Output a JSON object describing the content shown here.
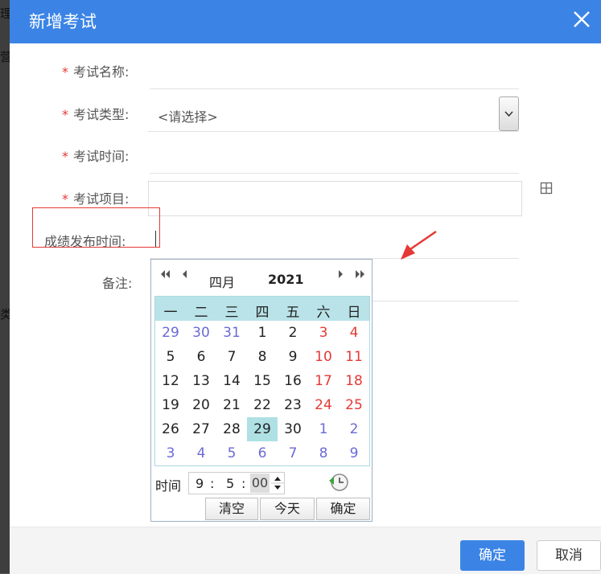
{
  "background": {
    "fragment_1": "理",
    "fragment_2": "营",
    "fragment_3": "类"
  },
  "dialog": {
    "title": "新增考试",
    "close_icon": "close-icon"
  },
  "form": {
    "required_mark": "*",
    "exam_name_label": "考试名称:",
    "exam_type_label": "考试类型:",
    "exam_type_value": "<请选择>",
    "exam_time_label": "考试时间:",
    "exam_item_label": "考试项目:",
    "result_time_label": "成绩发布时间:",
    "remark_label": "备注:"
  },
  "calendar": {
    "month": "四月",
    "year": "2021",
    "weekdays": [
      "一",
      "二",
      "三",
      "四",
      "五",
      "六",
      "日"
    ],
    "weeks": [
      [
        "29",
        "30",
        "31",
        "1",
        "2",
        "3",
        "4"
      ],
      [
        "5",
        "6",
        "7",
        "8",
        "9",
        "10",
        "11"
      ],
      [
        "12",
        "13",
        "14",
        "15",
        "16",
        "17",
        "18"
      ],
      [
        "19",
        "20",
        "21",
        "22",
        "23",
        "24",
        "25"
      ],
      [
        "26",
        "27",
        "28",
        "29",
        "30",
        "1",
        "2"
      ],
      [
        "3",
        "4",
        "5",
        "6",
        "7",
        "8",
        "9"
      ]
    ],
    "selected_day": "29",
    "time_label": "时间",
    "hour": "9",
    "minute": "5",
    "second": "00",
    "clear_label": "清空",
    "today_label": "今天",
    "confirm_label": "确定"
  },
  "footer": {
    "confirm_label": "确定",
    "cancel_label": "取消"
  },
  "colors": {
    "primary": "#3b84e6",
    "required": "#e53935",
    "weekend": "#e53935",
    "other_month": "#6a6ad6",
    "calendar_header": "#b9e3e8",
    "selected_day": "#aee0e4"
  }
}
